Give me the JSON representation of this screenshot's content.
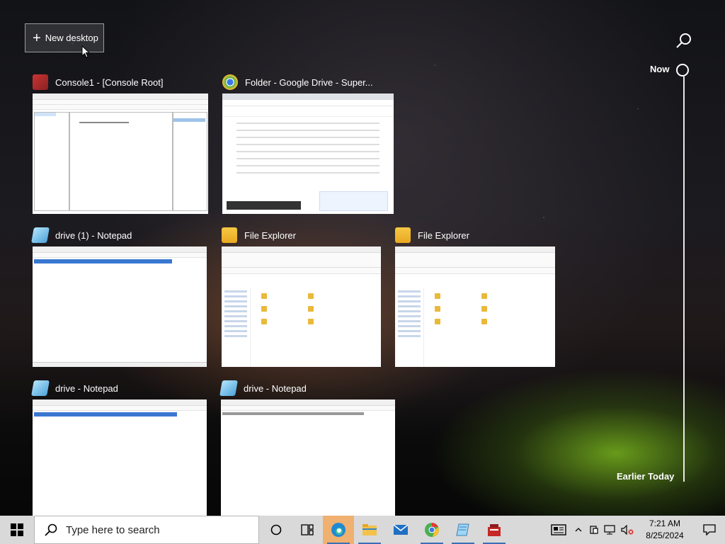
{
  "new_desktop": {
    "label": "New desktop"
  },
  "timeline": {
    "now_label": "Now",
    "earlier_label": "Earlier Today"
  },
  "windows": [
    {
      "title": "Console1 - [Console Root]",
      "icon": "mmc-icon"
    },
    {
      "title": "Folder - Google Drive - Super...",
      "icon": "chrome-icon"
    },
    {
      "title": "drive (1) - Notepad",
      "icon": "notepad-icon"
    },
    {
      "title": "File Explorer",
      "icon": "folder-icon"
    },
    {
      "title": "File Explorer",
      "icon": "folder-icon"
    },
    {
      "title": "drive - Notepad",
      "icon": "notepad-icon"
    },
    {
      "title": "drive - Notepad",
      "icon": "notepad-icon"
    }
  ],
  "taskbar": {
    "search_placeholder": "Type here to search",
    "apps": [
      "cortana-icon",
      "task-view-icon",
      "edge-icon",
      "file-explorer-icon",
      "mail-icon",
      "chrome-icon",
      "notepad-icon",
      "mmc-icon"
    ],
    "time": "7:21 AM",
    "date": "8/25/2024"
  },
  "colors": {
    "taskbar_bg": "#d9d9d9",
    "active_app_bg": "#f0b070",
    "accent": "#3b6fb6"
  }
}
